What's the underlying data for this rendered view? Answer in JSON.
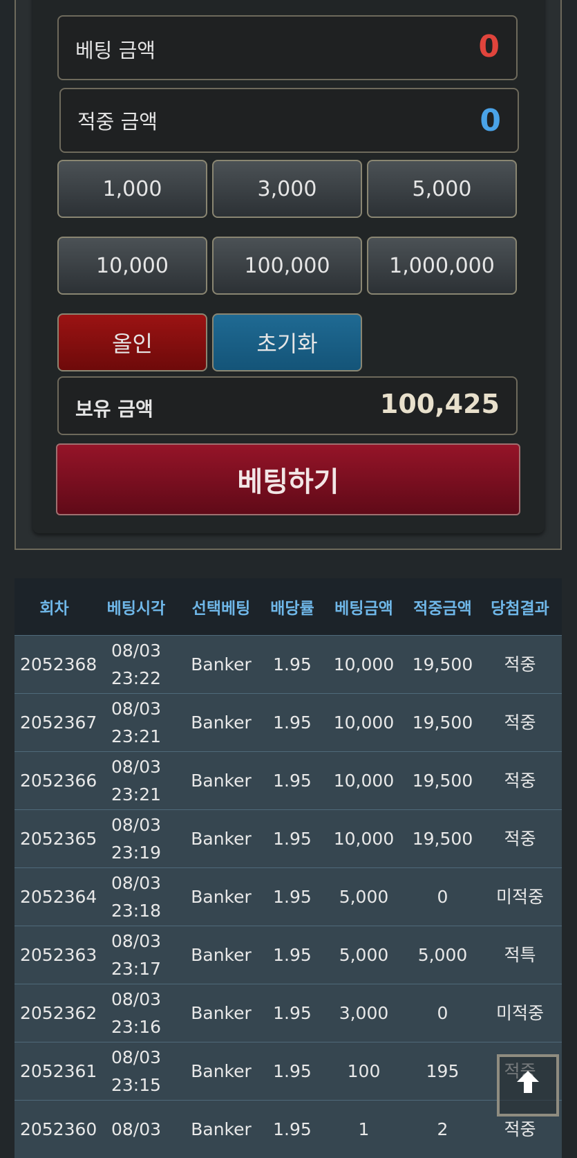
{
  "bet_panel": {
    "bet_amount_label": "베팅 금액",
    "bet_amount_value": "0",
    "win_amount_label": "적중 금액",
    "win_amount_value": "0",
    "chips": [
      "1,000",
      "3,000",
      "5,000",
      "10,000",
      "100,000",
      "1,000,000"
    ],
    "all_in_label": "올인",
    "reset_label": "초기화",
    "balance_label": "보유 금액",
    "balance_value": "100,425",
    "bet_button_label": "베팅하기"
  },
  "history": {
    "headers": [
      "회차",
      "베팅시각",
      "선택베팅",
      "배당률",
      "베팅금액",
      "적중금액",
      "당첨결과"
    ],
    "rows": [
      {
        "round": "2052368",
        "date": "08/03",
        "time": "23:22",
        "pick": "Banker",
        "odds": "1.95",
        "bet": "10,000",
        "win": "19,500",
        "result": "적중",
        "status": "win"
      },
      {
        "round": "2052367",
        "date": "08/03",
        "time": "23:21",
        "pick": "Banker",
        "odds": "1.95",
        "bet": "10,000",
        "win": "19,500",
        "result": "적중",
        "status": "win"
      },
      {
        "round": "2052366",
        "date": "08/03",
        "time": "23:21",
        "pick": "Banker",
        "odds": "1.95",
        "bet": "10,000",
        "win": "19,500",
        "result": "적중",
        "status": "win"
      },
      {
        "round": "2052365",
        "date": "08/03",
        "time": "23:19",
        "pick": "Banker",
        "odds": "1.95",
        "bet": "10,000",
        "win": "19,500",
        "result": "적중",
        "status": "win"
      },
      {
        "round": "2052364",
        "date": "08/03",
        "time": "23:18",
        "pick": "Banker",
        "odds": "1.95",
        "bet": "5,000",
        "win": "0",
        "result": "미적중",
        "status": "lose"
      },
      {
        "round": "2052363",
        "date": "08/03",
        "time": "23:17",
        "pick": "Banker",
        "odds": "1.95",
        "bet": "5,000",
        "win": "5,000",
        "result": "적특",
        "status": "win"
      },
      {
        "round": "2052362",
        "date": "08/03",
        "time": "23:16",
        "pick": "Banker",
        "odds": "1.95",
        "bet": "3,000",
        "win": "0",
        "result": "미적중",
        "status": "lose"
      },
      {
        "round": "2052361",
        "date": "08/03",
        "time": "23:15",
        "pick": "Banker",
        "odds": "1.95",
        "bet": "100",
        "win": "195",
        "result": "적중",
        "status": "win"
      },
      {
        "round": "2052360",
        "date": "08/03",
        "time": "",
        "pick": "Banker",
        "odds": "1.95",
        "bet": "1",
        "win": "2",
        "result": "적중",
        "status": "win"
      }
    ]
  },
  "colors": {
    "bet_value": "#e0443c",
    "win_value": "#4aa3e8",
    "balance_value": "#e8e0cc",
    "header_text": "#6fb7e8",
    "result_win": "#f0b030",
    "result_lose": "#f03c3c"
  },
  "icons": {
    "scroll_top": "arrow-up-icon"
  }
}
